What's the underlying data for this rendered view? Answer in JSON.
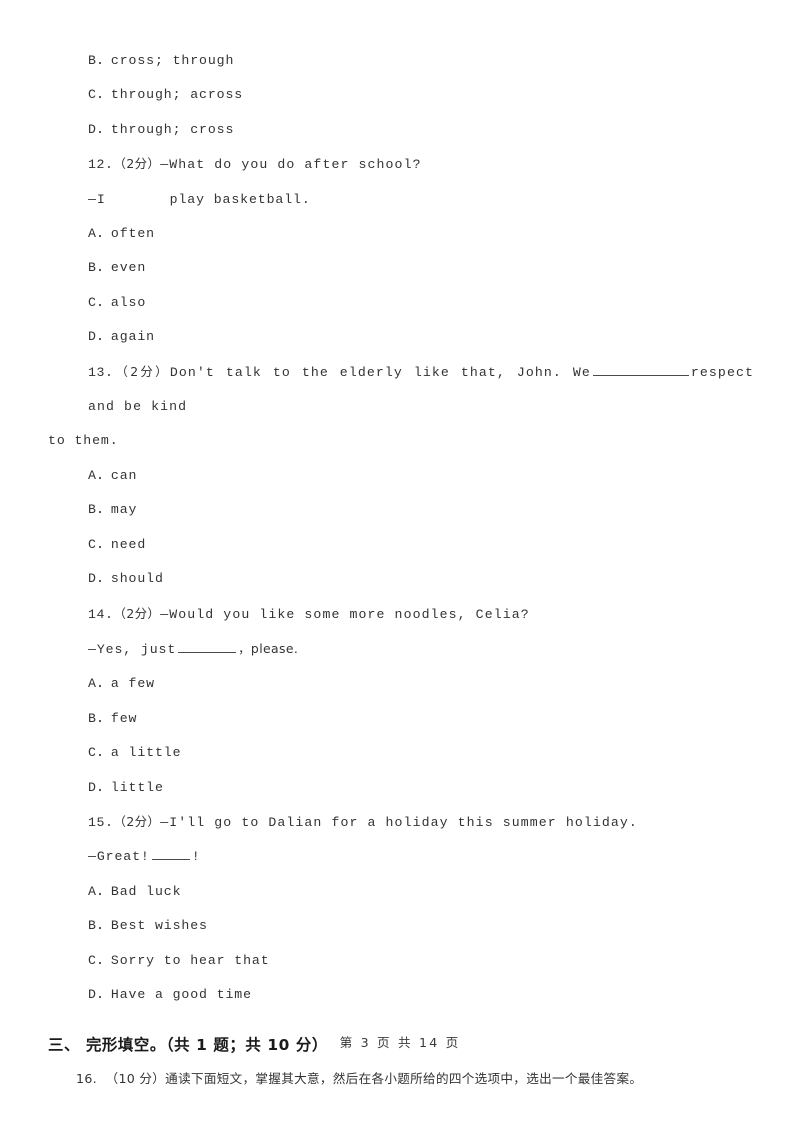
{
  "document": {
    "page_label": "第 3 页 共 14 页",
    "page_number": "3",
    "total_pages": "14"
  },
  "items": [
    {
      "key": "opt_11_b",
      "text": "B．cross; through"
    },
    {
      "key": "opt_11_c",
      "text": "C．through; across"
    },
    {
      "key": "opt_11_d",
      "text": "D．through; cross"
    }
  ],
  "q12": {
    "number": "12.",
    "score": "（2分）",
    "stem": "—What do you do after school?",
    "answer_line_prefix": "—I",
    "answer_line_suffix": "play basketball.",
    "options": [
      {
        "label": "A．often"
      },
      {
        "label": "B．even"
      },
      {
        "label": "C．also"
      },
      {
        "label": "D．again"
      }
    ]
  },
  "q13": {
    "number": "13.",
    "score": "（2分）",
    "stem_before_blank": "Don't talk to the elderly like that, John. We",
    "stem_after_blank": "respect and be kind",
    "continuation": "to them.",
    "options": [
      {
        "label": "A．can"
      },
      {
        "label": "B．may"
      },
      {
        "label": "C．need"
      },
      {
        "label": "D．should"
      }
    ]
  },
  "q14": {
    "number": "14.",
    "score": "（2分）",
    "stem": "—Would you like some more noodles, Celia?",
    "answer_prefix": "—Yes, just",
    "answer_suffix": "，please.",
    "options": [
      {
        "label": "A．a few"
      },
      {
        "label": "B．few"
      },
      {
        "label": "C．a little"
      },
      {
        "label": "D．little"
      }
    ]
  },
  "q15": {
    "number": "15.",
    "score": "（2分）",
    "stem": "—I'll go to Dalian for a holiday this summer holiday.",
    "answer_prefix": "—Great!",
    "answer_suffix": "!",
    "options": [
      {
        "label": "A．Bad luck"
      },
      {
        "label": "B．Best wishes"
      },
      {
        "label": "C．Sorry to hear that"
      },
      {
        "label": "D．Have a good time"
      }
    ]
  },
  "section3": {
    "heading": "三、 完形填空。（共 1 题；共 10 分）",
    "q16_number": "16.",
    "q16_score": "（10 分）",
    "q16_text": "通读下面短文，掌握其大意，然后在各小题所给的四个选项中，选出一个最佳答案。"
  }
}
